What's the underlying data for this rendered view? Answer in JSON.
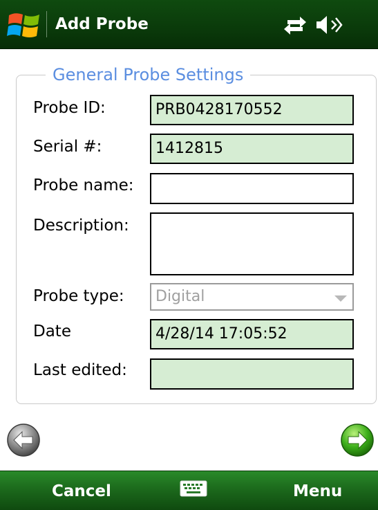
{
  "titlebar": {
    "title": "Add Probe",
    "start_icon": "windows-flag-icon",
    "network_icon": "network-sync-icon",
    "volume_icon": "speaker-icon"
  },
  "group": {
    "title": "General Probe Settings"
  },
  "fields": {
    "probe_id": {
      "label": "Probe ID:",
      "value": "PRB0428170552"
    },
    "serial": {
      "label": "Serial #:",
      "value": "1412815"
    },
    "probe_name": {
      "label": "Probe name:",
      "value": ""
    },
    "description": {
      "label": "Description:",
      "value": ""
    },
    "probe_type": {
      "label": "Probe type:",
      "value": "Digital"
    },
    "date": {
      "label": "Date",
      "value": "4/28/14 17:05:52"
    },
    "last_edited": {
      "label": "Last edited:",
      "value": ""
    }
  },
  "nav": {
    "back_icon": "back-arrow-icon",
    "next_icon": "next-arrow-icon"
  },
  "softkeys": {
    "left": "Cancel",
    "right": "Menu",
    "center_icon": "keyboard-icon"
  },
  "colors": {
    "titlebar": "#0a3a0a",
    "softkey_bar": "#1c6a1c",
    "readonly_field": "#d6edd3",
    "group_title": "#5b8ee0"
  }
}
